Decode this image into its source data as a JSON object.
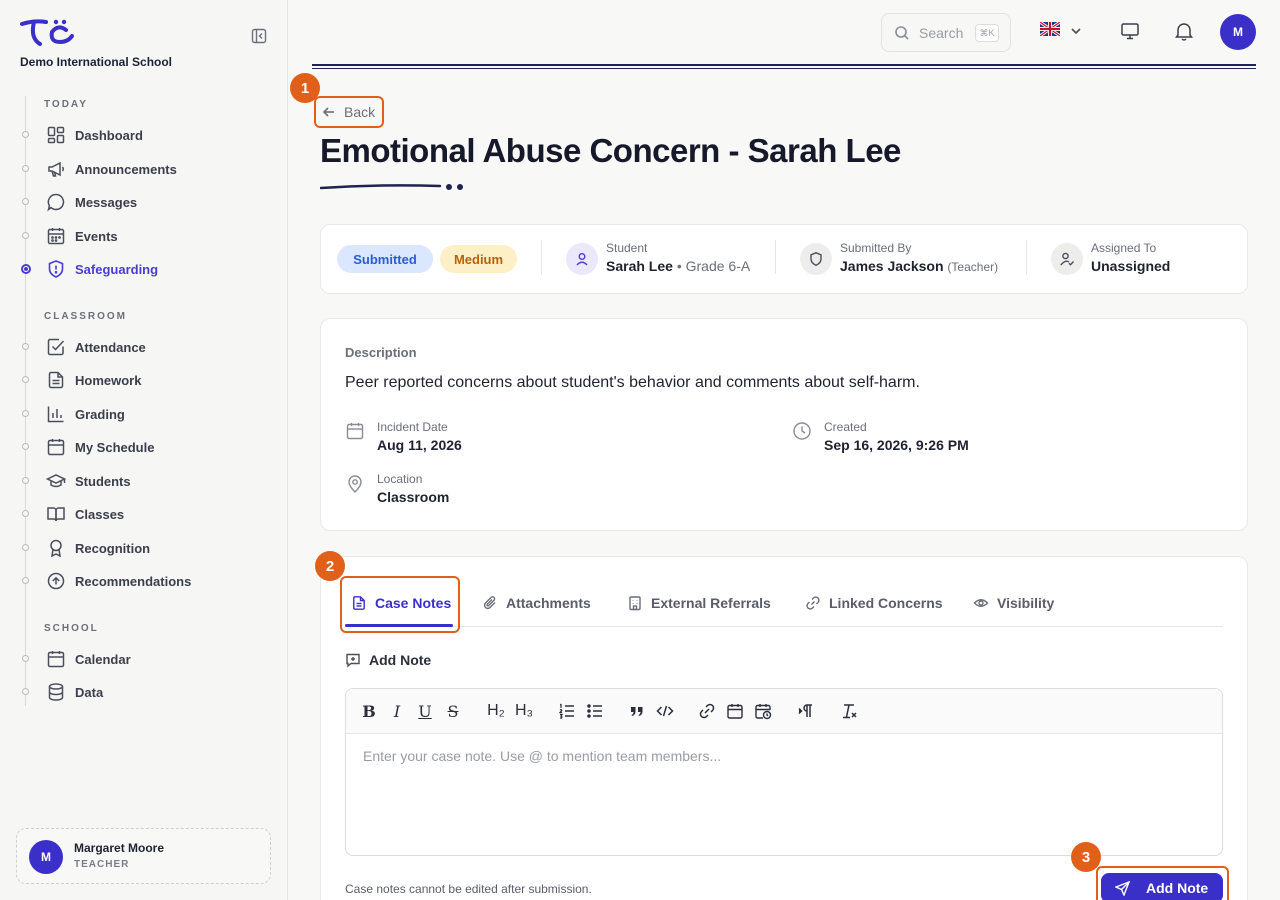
{
  "app": {
    "school_name": "Demo International School"
  },
  "sidebar": {
    "sections": [
      {
        "label": "TODAY"
      },
      {
        "label": "CLASSROOM"
      },
      {
        "label": "SCHOOL"
      }
    ],
    "items": [
      {
        "label": "Dashboard",
        "icon": "dashboard-icon"
      },
      {
        "label": "Announcements",
        "icon": "megaphone-icon"
      },
      {
        "label": "Messages",
        "icon": "chat-bubble-icon"
      },
      {
        "label": "Events",
        "icon": "calendar-icon"
      },
      {
        "label": "Safeguarding",
        "icon": "shield-alert-icon",
        "active": true
      },
      {
        "label": "Attendance",
        "icon": "checkbox-icon"
      },
      {
        "label": "Homework",
        "icon": "document-icon"
      },
      {
        "label": "Grading",
        "icon": "bar-chart-icon"
      },
      {
        "label": "My Schedule",
        "icon": "calendar-icon"
      },
      {
        "label": "Students",
        "icon": "graduation-cap-icon"
      },
      {
        "label": "Classes",
        "icon": "book-open-icon"
      },
      {
        "label": "Recognition",
        "icon": "award-icon"
      },
      {
        "label": "Recommendations",
        "icon": "arrow-up-circle-icon"
      },
      {
        "label": "Calendar",
        "icon": "calendar-icon"
      },
      {
        "label": "Data",
        "icon": "database-icon"
      }
    ],
    "user": {
      "initial": "M",
      "name": "Margaret Moore",
      "role": "TEACHER"
    }
  },
  "topbar": {
    "search_placeholder": "Search",
    "search_shortcut": "⌘K",
    "language_flag": "🇬🇧",
    "avatar_initial": "M"
  },
  "page": {
    "back_label": "Back",
    "title": "Emotional Abuse Concern - Sarah Lee"
  },
  "summary": {
    "status": "Submitted",
    "priority": "Medium",
    "student_label": "Student",
    "student_name": "Sarah Lee",
    "student_grade": "• Grade 6-A",
    "submitted_by_label": "Submitted By",
    "submitted_by_name": "James Jackson",
    "submitted_by_role": "(Teacher)",
    "assigned_to_label": "Assigned To",
    "assigned_to_value": "Unassigned"
  },
  "details": {
    "description_label": "Description",
    "description": "Peer reported concerns about student's behavior and comments about self-harm.",
    "incident_date_label": "Incident Date",
    "incident_date": "Aug 11, 2026",
    "created_label": "Created",
    "created": "Sep 16, 2026, 9:26 PM",
    "location_label": "Location",
    "location": "Classroom"
  },
  "tabs": [
    {
      "label": "Case Notes",
      "icon": "document-icon",
      "active": true
    },
    {
      "label": "Attachments",
      "icon": "paperclip-icon"
    },
    {
      "label": "External Referrals",
      "icon": "building-icon"
    },
    {
      "label": "Linked Concerns",
      "icon": "link-icon"
    },
    {
      "label": "Visibility",
      "icon": "eye-icon"
    }
  ],
  "notes": {
    "heading": "Add Note",
    "placeholder": "Enter your case note. Use @ to mention team members...",
    "footnote": "Case notes cannot be edited after submission.",
    "submit_label": "Add Note"
  },
  "toolbar_glyphs": {
    "bold": "B",
    "italic": "I",
    "underline": "U",
    "strike": "S",
    "h2": "H₂",
    "h3": "H₃"
  },
  "annotations": [
    "1",
    "2",
    "3"
  ],
  "colors": {
    "accent": "#3b2fc9",
    "highlight": "#e0601a",
    "submitted_bg": "#dbe6ff",
    "submitted_fg": "#2b5bd6",
    "medium_bg": "#fdf0c7",
    "medium_fg": "#b8600b"
  }
}
